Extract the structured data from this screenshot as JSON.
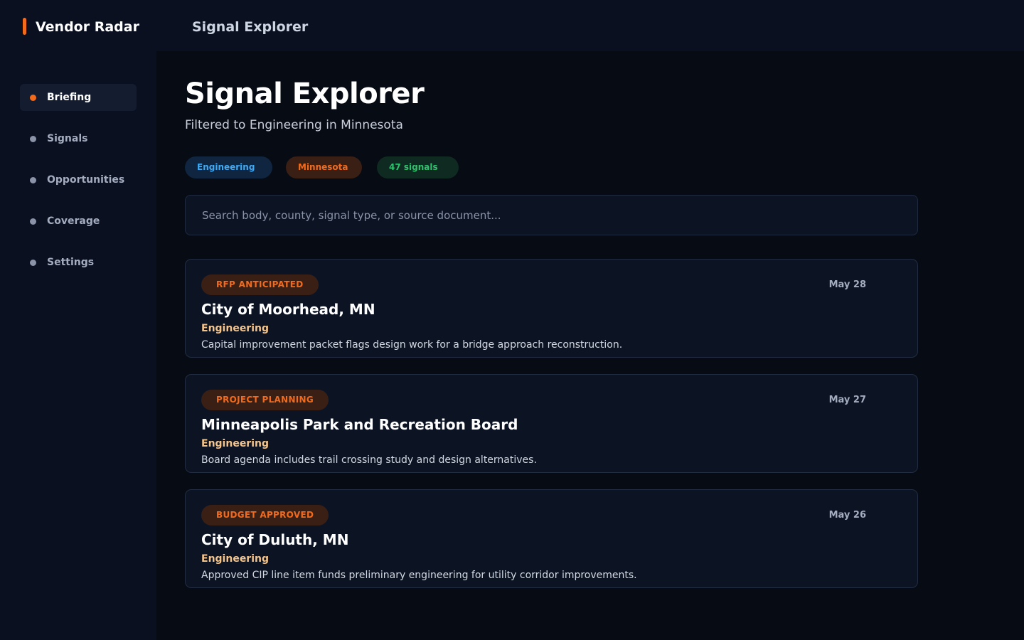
{
  "app": {
    "brand": "Vendor Radar",
    "header_title": "Signal Explorer"
  },
  "sidebar": {
    "items": [
      {
        "label": "Briefing",
        "active": true
      },
      {
        "label": "Signals",
        "active": false
      },
      {
        "label": "Opportunities",
        "active": false
      },
      {
        "label": "Coverage",
        "active": false
      },
      {
        "label": "Settings",
        "active": false
      }
    ]
  },
  "main": {
    "title": "Signal Explorer",
    "subtitle": "Filtered to Engineering in Minnesota",
    "chips": {
      "category": "Engineering",
      "state": "Minnesota",
      "count": "47 signals"
    },
    "search": {
      "placeholder": "Search body, county, signal type, or source document...",
      "value": ""
    },
    "signals": [
      {
        "badge": "RFP ANTICIPATED",
        "date": "May 28",
        "title": "City of Moorhead, MN",
        "category": "Engineering",
        "description": "Capital improvement packet flags design work for a bridge approach reconstruction."
      },
      {
        "badge": "PROJECT PLANNING",
        "date": "May 27",
        "title": "Minneapolis Park and Recreation Board",
        "category": "Engineering",
        "description": "Board agenda includes trail crossing study and design alternatives."
      },
      {
        "badge": "BUDGET APPROVED",
        "date": "May 26",
        "title": "City of Duluth, MN",
        "category": "Engineering",
        "description": "Approved CIP line item funds preliminary engineering for utility corridor improvements."
      }
    ]
  },
  "colors": {
    "accent": "#f26b1d",
    "background": "#070b14",
    "panel": "#0a1020",
    "card": "#0c1424",
    "chip_blue": "#3fa9f5",
    "chip_green": "#2fc26c",
    "category_text": "#f5c48a"
  }
}
